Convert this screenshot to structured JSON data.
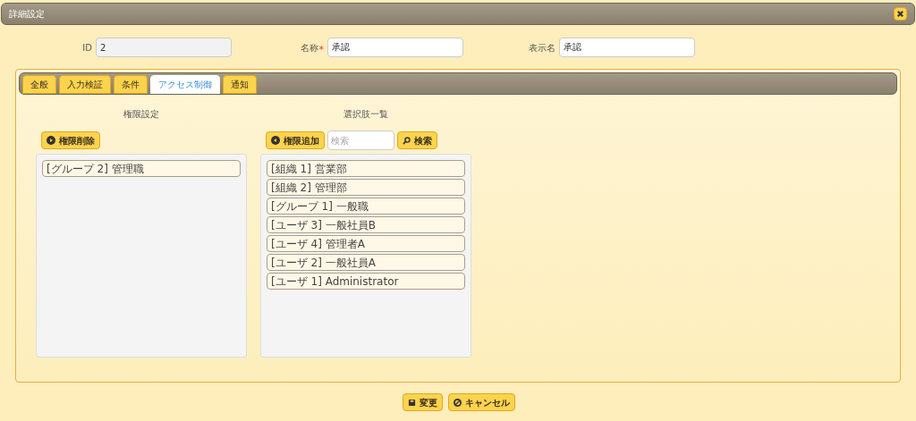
{
  "window": {
    "title": "詳細設定"
  },
  "fields": [
    {
      "label": "ID",
      "value": "2",
      "disabled": true
    },
    {
      "label": "名称",
      "required_mark": "*",
      "value": "承認",
      "disabled": false
    },
    {
      "label": "表示名",
      "value": "承認",
      "disabled": false
    }
  ],
  "tabs": [
    {
      "label": "全般",
      "selected": false
    },
    {
      "label": "入力検証",
      "selected": false
    },
    {
      "label": "条件",
      "selected": false
    },
    {
      "label": "アクセス制御",
      "selected": true
    },
    {
      "label": "通知",
      "selected": false
    }
  ],
  "assigned": {
    "heading": "権限設定",
    "remove_button": "権限削除",
    "items": [
      "[グループ 2] 管理職"
    ]
  },
  "choices": {
    "heading": "選択肢一覧",
    "add_button": "権限追加",
    "search": {
      "placeholder": "検索"
    },
    "search_button": "検索",
    "items": [
      "[組織 1] 営業部",
      "[組織 2] 管理部",
      "[グループ 1] 一般職",
      "[ユーザ 3] 一般社員B",
      "[ユーザ 4] 管理者A",
      "[ユーザ 2] 一般社員A",
      "[ユーザ 1] Administrator"
    ]
  },
  "footer_buttons": [
    {
      "kind": "save",
      "label": "変更"
    },
    {
      "kind": "cancel",
      "label": "キャンセル"
    }
  ]
}
